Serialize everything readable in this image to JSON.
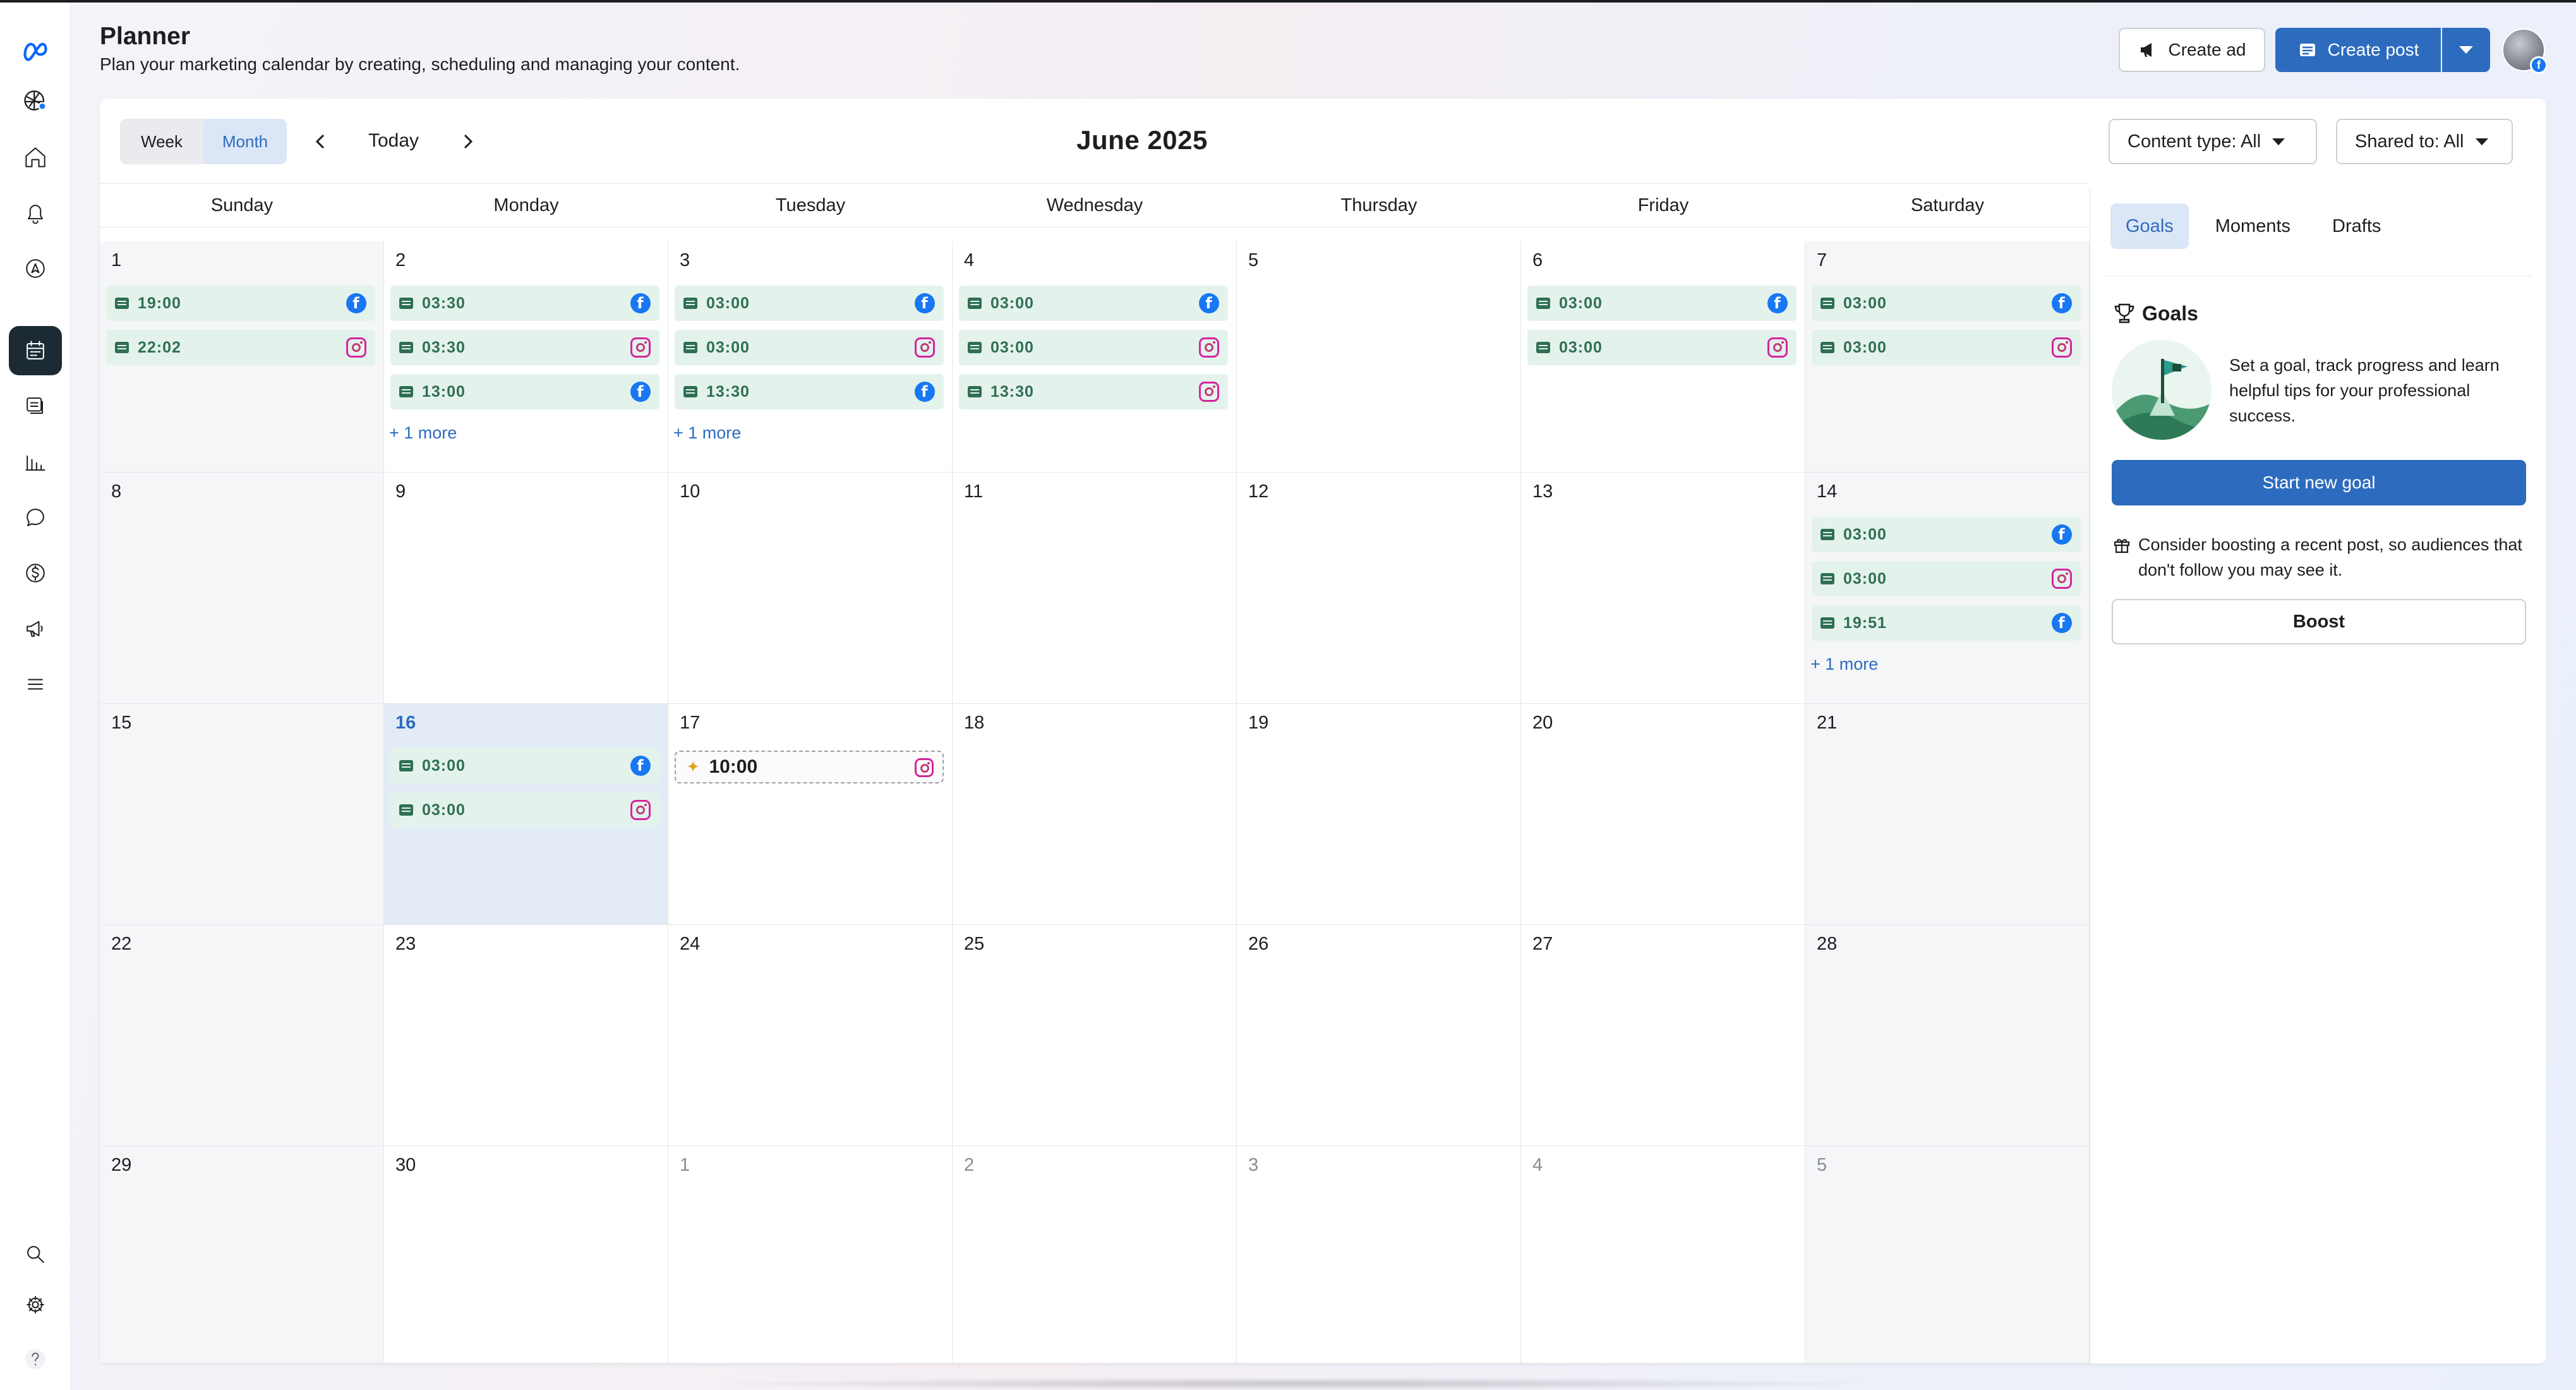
{
  "header": {
    "title": "Planner",
    "subtitle": "Plan your marketing calendar by creating, scheduling and managing your content.",
    "create_ad_label": "Create ad",
    "create_post_label": "Create post"
  },
  "toolbar": {
    "view_week": "Week",
    "view_month": "Month",
    "active_view": "Month",
    "today_label": "Today",
    "month_title": "June 2025",
    "content_type_filter": "Content type: All",
    "shared_to_filter": "Shared to: All"
  },
  "weekdays": [
    "Sunday",
    "Monday",
    "Tuesday",
    "Wednesday",
    "Thursday",
    "Friday",
    "Saturday"
  ],
  "calendar": {
    "today": "16",
    "weeks": [
      [
        {
          "day": "1",
          "weekend": true,
          "events": [
            {
              "time": "19:00",
              "platform": "facebook"
            },
            {
              "time": "22:02",
              "platform": "instagram"
            }
          ]
        },
        {
          "day": "2",
          "events": [
            {
              "time": "03:30",
              "platform": "facebook"
            },
            {
              "time": "03:30",
              "platform": "instagram"
            },
            {
              "time": "13:00",
              "platform": "facebook"
            }
          ],
          "more": "+ 1 more"
        },
        {
          "day": "3",
          "events": [
            {
              "time": "03:00",
              "platform": "facebook"
            },
            {
              "time": "03:00",
              "platform": "instagram"
            },
            {
              "time": "13:30",
              "platform": "facebook"
            }
          ],
          "more": "+ 1 more"
        },
        {
          "day": "4",
          "events": [
            {
              "time": "03:00",
              "platform": "facebook"
            },
            {
              "time": "03:00",
              "platform": "instagram"
            },
            {
              "time": "13:30",
              "platform": "instagram"
            }
          ]
        },
        {
          "day": "5",
          "events": []
        },
        {
          "day": "6",
          "events": [
            {
              "time": "03:00",
              "platform": "facebook"
            },
            {
              "time": "03:00",
              "platform": "instagram"
            }
          ]
        },
        {
          "day": "7",
          "weekend": true,
          "events": [
            {
              "time": "03:00",
              "platform": "facebook"
            },
            {
              "time": "03:00",
              "platform": "instagram"
            }
          ]
        }
      ],
      [
        {
          "day": "8",
          "weekend": true,
          "events": []
        },
        {
          "day": "9",
          "events": []
        },
        {
          "day": "10",
          "events": []
        },
        {
          "day": "11",
          "events": []
        },
        {
          "day": "12",
          "events": []
        },
        {
          "day": "13",
          "events": []
        },
        {
          "day": "14",
          "weekend": true,
          "events": [
            {
              "time": "03:00",
              "platform": "facebook"
            },
            {
              "time": "03:00",
              "platform": "instagram"
            },
            {
              "time": "19:51",
              "platform": "facebook"
            }
          ],
          "more": "+ 1 more"
        }
      ],
      [
        {
          "day": "15",
          "weekend": true,
          "events": []
        },
        {
          "day": "16",
          "today": true,
          "events": [
            {
              "time": "03:00",
              "platform": "facebook"
            },
            {
              "time": "03:00",
              "platform": "instagram"
            }
          ]
        },
        {
          "day": "17",
          "events": [],
          "draft": {
            "time": "10:00",
            "platform": "instagram"
          }
        },
        {
          "day": "18",
          "events": []
        },
        {
          "day": "19",
          "events": []
        },
        {
          "day": "20",
          "events": []
        },
        {
          "day": "21",
          "weekend": true,
          "events": []
        }
      ],
      [
        {
          "day": "22",
          "weekend": true,
          "events": []
        },
        {
          "day": "23",
          "events": []
        },
        {
          "day": "24",
          "events": []
        },
        {
          "day": "25",
          "events": []
        },
        {
          "day": "26",
          "events": []
        },
        {
          "day": "27",
          "events": []
        },
        {
          "day": "28",
          "weekend": true,
          "events": []
        }
      ],
      [
        {
          "day": "29",
          "weekend": true,
          "events": []
        },
        {
          "day": "30",
          "events": []
        },
        {
          "day": "1",
          "other": true,
          "events": []
        },
        {
          "day": "2",
          "other": true,
          "events": []
        },
        {
          "day": "3",
          "other": true,
          "events": []
        },
        {
          "day": "4",
          "other": true,
          "events": []
        },
        {
          "day": "5",
          "other": true,
          "weekend": true,
          "events": []
        }
      ]
    ]
  },
  "panel": {
    "tabs": [
      "Goals",
      "Moments",
      "Drafts"
    ],
    "active_tab": "Goals",
    "goals_heading": "Goals",
    "goals_text": "Set a goal, track progress and learn helpful tips for your professional success.",
    "start_goal_label": "Start new goal",
    "boost_text": "Consider boosting a recent post, so audiences that don't follow you may see it.",
    "boost_label": "Boost"
  },
  "icons": {
    "nav": [
      "meta-logo-icon",
      "account-avatar-icon",
      "home-icon",
      "bell-icon",
      "compass-icon",
      "calendar-icon",
      "content-icon",
      "insights-icon",
      "inbox-icon",
      "monetization-icon",
      "ads-icon",
      "menu-icon",
      "search-icon",
      "gear-icon",
      "help-icon"
    ]
  },
  "colors": {
    "accent": "#2d6bbf",
    "event_bg": "#e4f2ec",
    "event_text": "#2f6f55",
    "facebook": "#1877f2",
    "instagram": "#d6249f"
  }
}
